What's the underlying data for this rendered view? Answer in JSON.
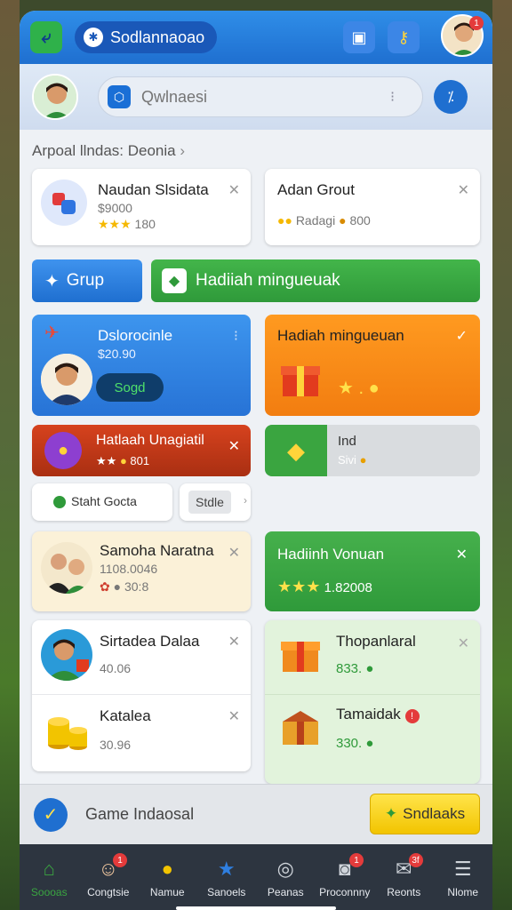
{
  "header": {
    "title": "Sodlannaoao",
    "notif_count": "1"
  },
  "search": {
    "placeholder": "Qwlnaesi"
  },
  "breadcrumb": "Arpoal llndas: Deonia",
  "friends": [
    {
      "name": "Naudan Slsidata",
      "sub": "$9000",
      "score": "180"
    },
    {
      "name": "Adan Grout",
      "sub": "Radagi",
      "score": "800"
    }
  ],
  "buttons": {
    "group": "Grup",
    "gift": "Hadiiah mingueuak"
  },
  "feature_cards": {
    "blue": {
      "title": "Dslorocinle",
      "amount": "$20.90",
      "btn": "Sogd"
    },
    "orange": {
      "title": "Hadiah mingueuan"
    },
    "red": {
      "title": "Hatlaah Unagiatil",
      "score": "801"
    },
    "gray": {
      "title": "Ind",
      "sub": "Sivi"
    }
  },
  "chips": {
    "chip1": "Staht Gocta",
    "chip2": "Stdle"
  },
  "list_left": [
    {
      "name": "Samoha Naratna",
      "sub": "1108.0046",
      "score": "30:8"
    },
    {
      "name": "Sirtadea Dalaa",
      "sub": "40.06"
    },
    {
      "name": "Katalea",
      "sub": "30.96"
    }
  ],
  "list_right": {
    "green_banner": {
      "title": "Hadiinh Vonuan",
      "score": "1.82008"
    },
    "items": [
      {
        "name": "Thopanlaral",
        "value": "833."
      },
      {
        "name": "Tamaidak",
        "value": "330."
      }
    ]
  },
  "bottom": {
    "label": "Game Indaosal",
    "action": "Sndlaaks"
  },
  "nav": [
    {
      "label": "Soooas",
      "icon": "home-icon"
    },
    {
      "label": "Congtsie",
      "icon": "face-icon",
      "badge": "1"
    },
    {
      "label": "Namue",
      "icon": "coin-icon"
    },
    {
      "label": "Sanoels",
      "icon": "star-icon"
    },
    {
      "label": "Peanas",
      "icon": "whistle-icon"
    },
    {
      "label": "Proconnny",
      "icon": "camera-icon",
      "badge": "1"
    },
    {
      "label": "Reonts",
      "icon": "mail-icon",
      "badge": "3f"
    },
    {
      "label": "Nlome",
      "icon": "menu-icon"
    }
  ],
  "colors": {
    "primary": "#1f6fd0",
    "green": "#2f9a3a",
    "orange": "#f48a16",
    "red": "#c2391a",
    "yellow": "#f2c400"
  }
}
